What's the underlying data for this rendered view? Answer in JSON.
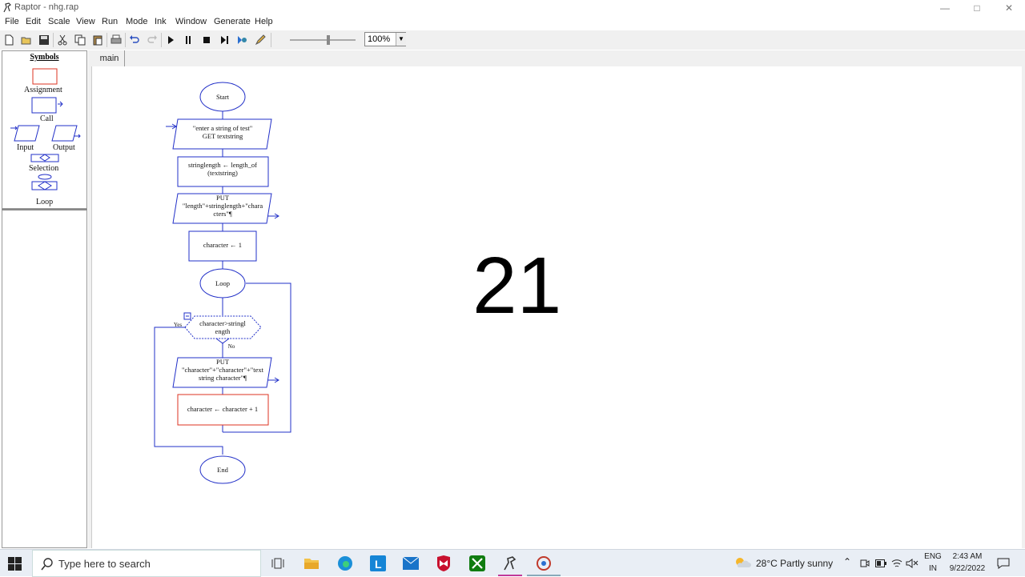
{
  "window": {
    "title": "Raptor - nhg.rap"
  },
  "menu": [
    "File",
    "Edit",
    "Scale",
    "View",
    "Run",
    "Mode",
    "Ink",
    "Window",
    "Generate",
    "Help"
  ],
  "toolbar": {
    "icons": [
      "new-icon",
      "open-icon",
      "save-icon",
      "cut-icon",
      "copy-icon",
      "paste-icon",
      "print-icon",
      "undo-icon",
      "redo-icon",
      "play-icon",
      "pause-icon",
      "stop-icon",
      "step-icon",
      "test-server-icon",
      "pen-icon"
    ],
    "zoom": "100%"
  },
  "symbols": {
    "title": "Symbols",
    "assignment": "Assignment",
    "call": "Call",
    "input": "Input",
    "output": "Output",
    "selection": "Selection",
    "loop": "Loop"
  },
  "tabs": [
    "main"
  ],
  "flowchart": {
    "start": "Start",
    "input_line1": "\"enter a string of test\"",
    "input_line2": "GET textstring",
    "assign1_line1": "stringlength ← length_of",
    "assign1_line2": "(textstring)",
    "output1_line1": "PUT",
    "output1_line2": "\"length\"+stringlength+\"chara",
    "output1_line3": "cters\"¶",
    "assign2": "character  ← 1",
    "loop": "Loop",
    "selection_line1": "character>stringl",
    "selection_line2": "ength",
    "yes": "Yes",
    "no": "No",
    "output2_line1": "PUT",
    "output2_line2": "\"character\"+\"character\"+\"text",
    "output2_line3": "string character\"¶",
    "assign3": "character ← character + 1",
    "end": "End"
  },
  "overlay_number": "21",
  "taskbar": {
    "search_placeholder": "Type here to search",
    "weather": "28°C  Partly sunny",
    "lang_line1": "ENG",
    "lang_line2": "IN",
    "time": "2:43 AM",
    "date": "9/22/2022"
  }
}
